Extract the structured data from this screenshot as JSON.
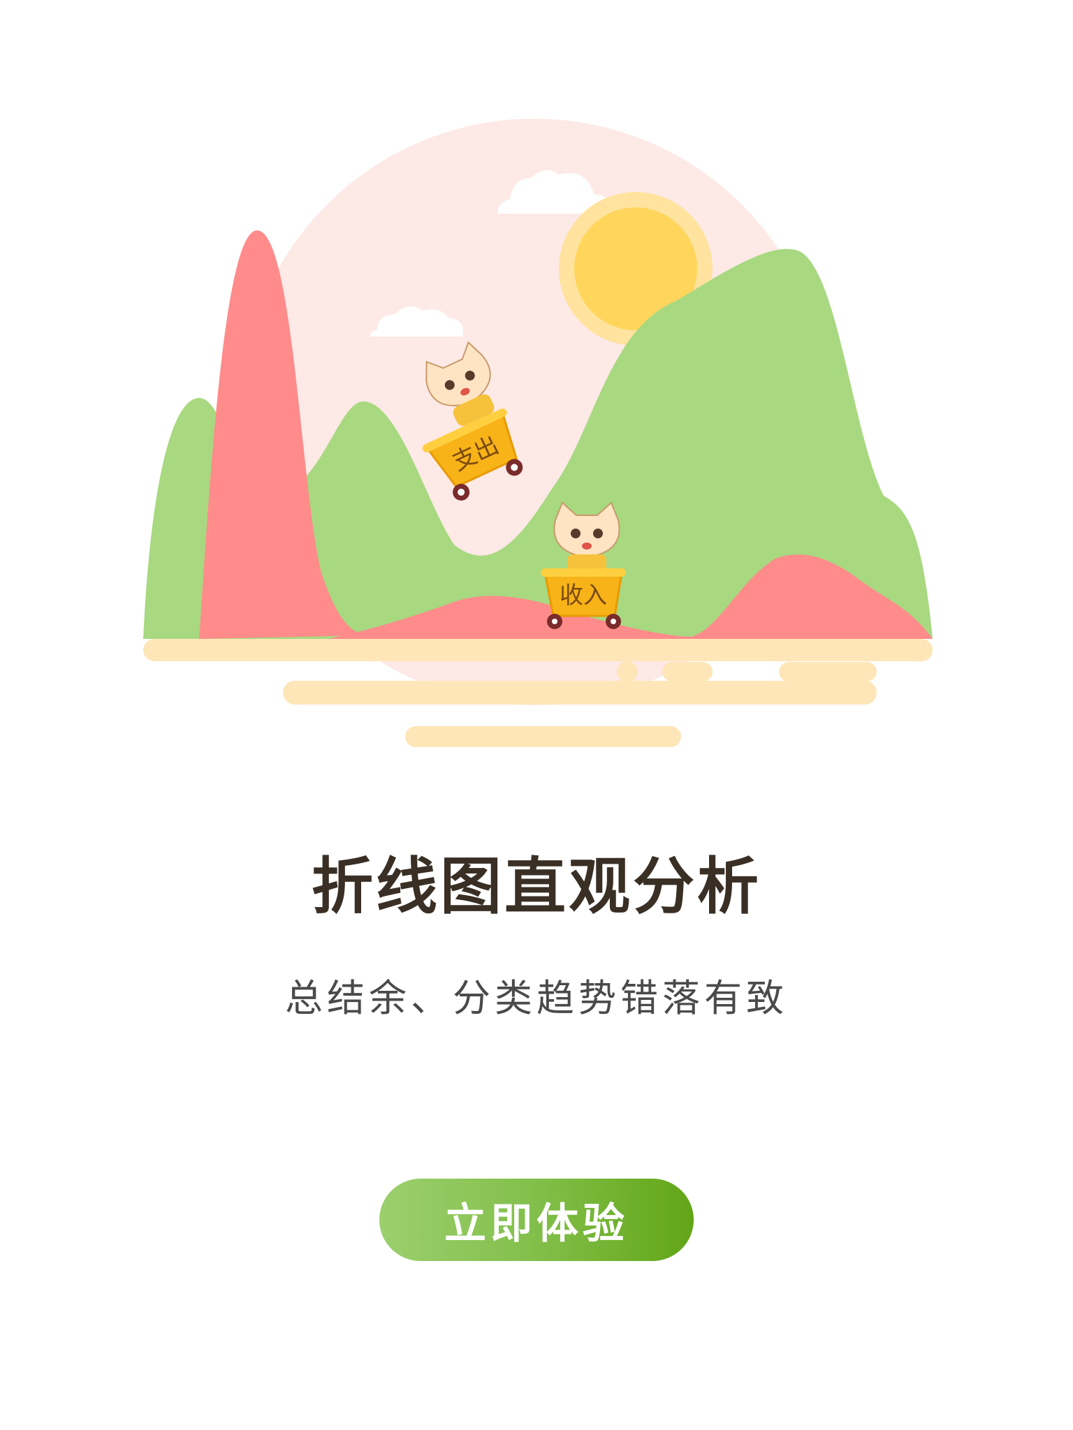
{
  "illustration": {
    "cart_expense_label": "支出",
    "cart_income_label": "收入"
  },
  "main": {
    "title": "折线图直观分析",
    "subtitle": "总结余、分类趋势错落有致"
  },
  "cta": {
    "label": "立即体验"
  },
  "colors": {
    "accent_green": "#6aad1e",
    "mountain_green": "#a8d880",
    "mountain_red": "#ff8b8b",
    "sun": "#ffd55c",
    "ground": "#ffe6b8",
    "sky_circle": "#fde9e6"
  }
}
